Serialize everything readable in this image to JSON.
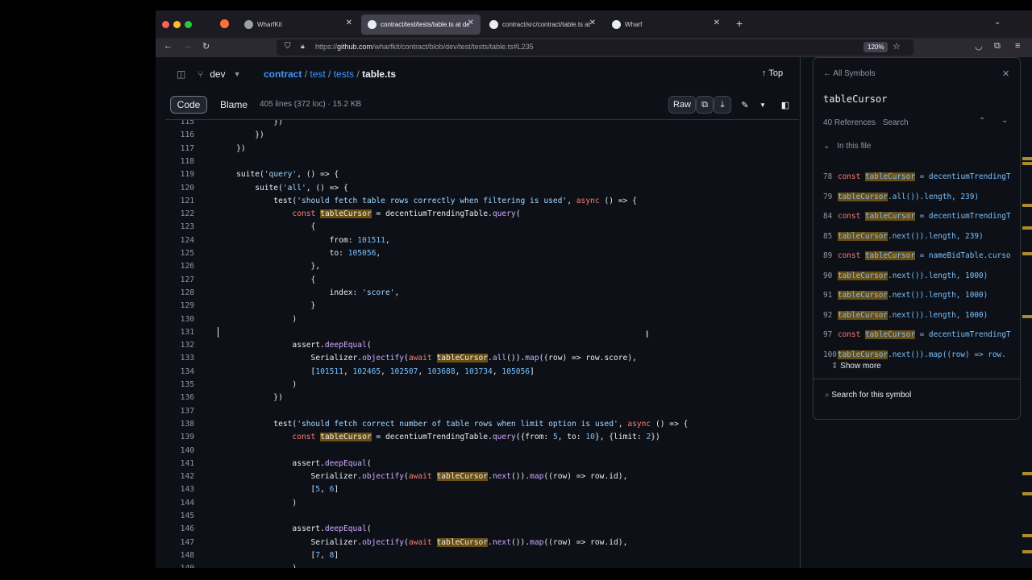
{
  "browser": {
    "tabs": [
      {
        "label": "WharfKit",
        "color": "#9aa0a6"
      },
      {
        "label": "contract/test/tests/table.ts at de",
        "color": "#e6edf3"
      },
      {
        "label": "contract/src/contract/table.ts at",
        "color": "#e6edf3"
      },
      {
        "label": "Wharf",
        "color": "#e6edf3"
      }
    ],
    "url_prefix": "https://",
    "url_host": "github.com",
    "url_path": "/wharfkit/contract/blob/dev/test/tests/table.ts#L235",
    "zoom": "120%",
    "new_tab": "+",
    "close_glyph": "✕"
  },
  "repo": {
    "branch": "dev",
    "path": [
      "contract",
      "test",
      "tests"
    ],
    "file": "table.ts",
    "top_label": "Top",
    "code_tab": "Code",
    "blame_tab": "Blame",
    "meta": "405 lines (372 loc) · 15.2 KB",
    "raw_label": "Raw"
  },
  "code_lines": [
    {
      "n": "115",
      "html": "            })"
    },
    {
      "n": "116",
      "html": "        })"
    },
    {
      "n": "117",
      "html": "    })"
    },
    {
      "n": "118",
      "html": ""
    },
    {
      "n": "119",
      "html": "    suite(<span class=\"str\">'query'</span>, () => {"
    },
    {
      "n": "120",
      "html": "        suite(<span class=\"str\">'all'</span>, () => {"
    },
    {
      "n": "121",
      "html": "            test(<span class=\"str\">'should fetch table rows correctly when filtering is used'</span>, <span class=\"kw\">async</span> () => {"
    },
    {
      "n": "122",
      "html": "                <span class=\"kw\">const</span> <span class=\"hl\">tableCursor</span> = decentiumTrendingTable.<span class=\"fn\">query</span>("
    },
    {
      "n": "123",
      "html": "                    {"
    },
    {
      "n": "124",
      "html": "                        from: <span class=\"num\">101511</span>,"
    },
    {
      "n": "125",
      "html": "                        to: <span class=\"num\">105056</span>,"
    },
    {
      "n": "126",
      "html": "                    },"
    },
    {
      "n": "127",
      "html": "                    {"
    },
    {
      "n": "128",
      "html": "                        index: <span class=\"str\">'score'</span>,"
    },
    {
      "n": "129",
      "html": "                    }"
    },
    {
      "n": "130",
      "html": "                )"
    },
    {
      "n": "131",
      "html": ""
    },
    {
      "n": "132",
      "html": "                assert.<span class=\"fn\">deepEqual</span>("
    },
    {
      "n": "133",
      "html": "                    Serializer.<span class=\"fn\">objectify</span>(<span class=\"kw\">await</span> <span class=\"hl\">tableCursor</span>.<span class=\"fn\">all</span>()).<span class=\"fn\">map</span>((row) => row.score),"
    },
    {
      "n": "134",
      "html": "                    [<span class=\"num\">101511</span>, <span class=\"num\">102465</span>, <span class=\"num\">102507</span>, <span class=\"num\">103688</span>, <span class=\"num\">103734</span>, <span class=\"num\">105056</span>]"
    },
    {
      "n": "135",
      "html": "                )"
    },
    {
      "n": "136",
      "html": "            })"
    },
    {
      "n": "137",
      "html": ""
    },
    {
      "n": "138",
      "html": "            test(<span class=\"str\">'should fetch correct number of table rows when limit option is used'</span>, <span class=\"kw\">async</span> () => {"
    },
    {
      "n": "139",
      "html": "                <span class=\"kw\">const</span> <span class=\"hl\">tableCursor</span> = decentiumTrendingTable.<span class=\"fn\">query</span>({from: <span class=\"num\">5</span>, to: <span class=\"num\">10</span>}, {limit: <span class=\"num\">2</span>})"
    },
    {
      "n": "140",
      "html": ""
    },
    {
      "n": "141",
      "html": "                assert.<span class=\"fn\">deepEqual</span>("
    },
    {
      "n": "142",
      "html": "                    Serializer.<span class=\"fn\">objectify</span>(<span class=\"kw\">await</span> <span class=\"hl\">tableCursor</span>.<span class=\"fn\">next</span>()).<span class=\"fn\">map</span>((row) => row.id),"
    },
    {
      "n": "143",
      "html": "                    [<span class=\"num\">5</span>, <span class=\"num\">6</span>]"
    },
    {
      "n": "144",
      "html": "                )"
    },
    {
      "n": "145",
      "html": ""
    },
    {
      "n": "146",
      "html": "                assert.<span class=\"fn\">deepEqual</span>("
    },
    {
      "n": "147",
      "html": "                    Serializer.<span class=\"fn\">objectify</span>(<span class=\"kw\">await</span> <span class=\"hl\">tableCursor</span>.<span class=\"fn\">next</span>()).<span class=\"fn\">map</span>((row) => row.id),"
    },
    {
      "n": "148",
      "html": "                    [<span class=\"num\">7</span>, <span class=\"num\">8</span>]"
    },
    {
      "n": "149",
      "html": "                )"
    }
  ],
  "symbols": {
    "back_label": "All Symbols",
    "title": "tableCursor",
    "refs_count": "40 References",
    "search_label": "Search",
    "section": "In this file",
    "refs": [
      {
        "n": "78",
        "html": "<span class=\"kw\">const</span> <span class=\"refhl\">tableCursor</span> <span class=\"prop\">= decentiumTrendingT</span>"
      },
      {
        "n": "79",
        "html": "<span class=\"refhl\">tableCursor</span><span class=\"prop\">.all()).length, 239)</span>"
      },
      {
        "n": "84",
        "html": "<span class=\"kw\">const</span> <span class=\"refhl\">tableCursor</span> <span class=\"prop\">= decentiumTrendingT</span>"
      },
      {
        "n": "85",
        "html": "<span class=\"refhl\">tableCursor</span><span class=\"prop\">.next()).length, 239)</span>"
      },
      {
        "n": "89",
        "html": "<span class=\"kw\">const</span> <span class=\"refhl\">tableCursor</span> <span class=\"prop\">= nameBidTable.curso</span>"
      },
      {
        "n": "90",
        "html": "<span class=\"refhl\">tableCursor</span><span class=\"prop\">.next()).length, 1000)</span>"
      },
      {
        "n": "91",
        "html": "<span class=\"refhl\">tableCursor</span><span class=\"prop\">.next()).length, 1000)</span>"
      },
      {
        "n": "92",
        "html": "<span class=\"refhl\">tableCursor</span><span class=\"prop\">.next()).length, 1000)</span>"
      },
      {
        "n": "97",
        "html": "<span class=\"kw\">const</span> <span class=\"refhl\">tableCursor</span> <span class=\"prop\">= decentiumTrendingT</span>"
      },
      {
        "n": "100",
        "html": "<span class=\"refhl\">tableCursor</span><span class=\"prop\">.next()).map((row) => row.</span>"
      }
    ],
    "show_more": "Show more",
    "search_symbol": "Search for this symbol"
  }
}
